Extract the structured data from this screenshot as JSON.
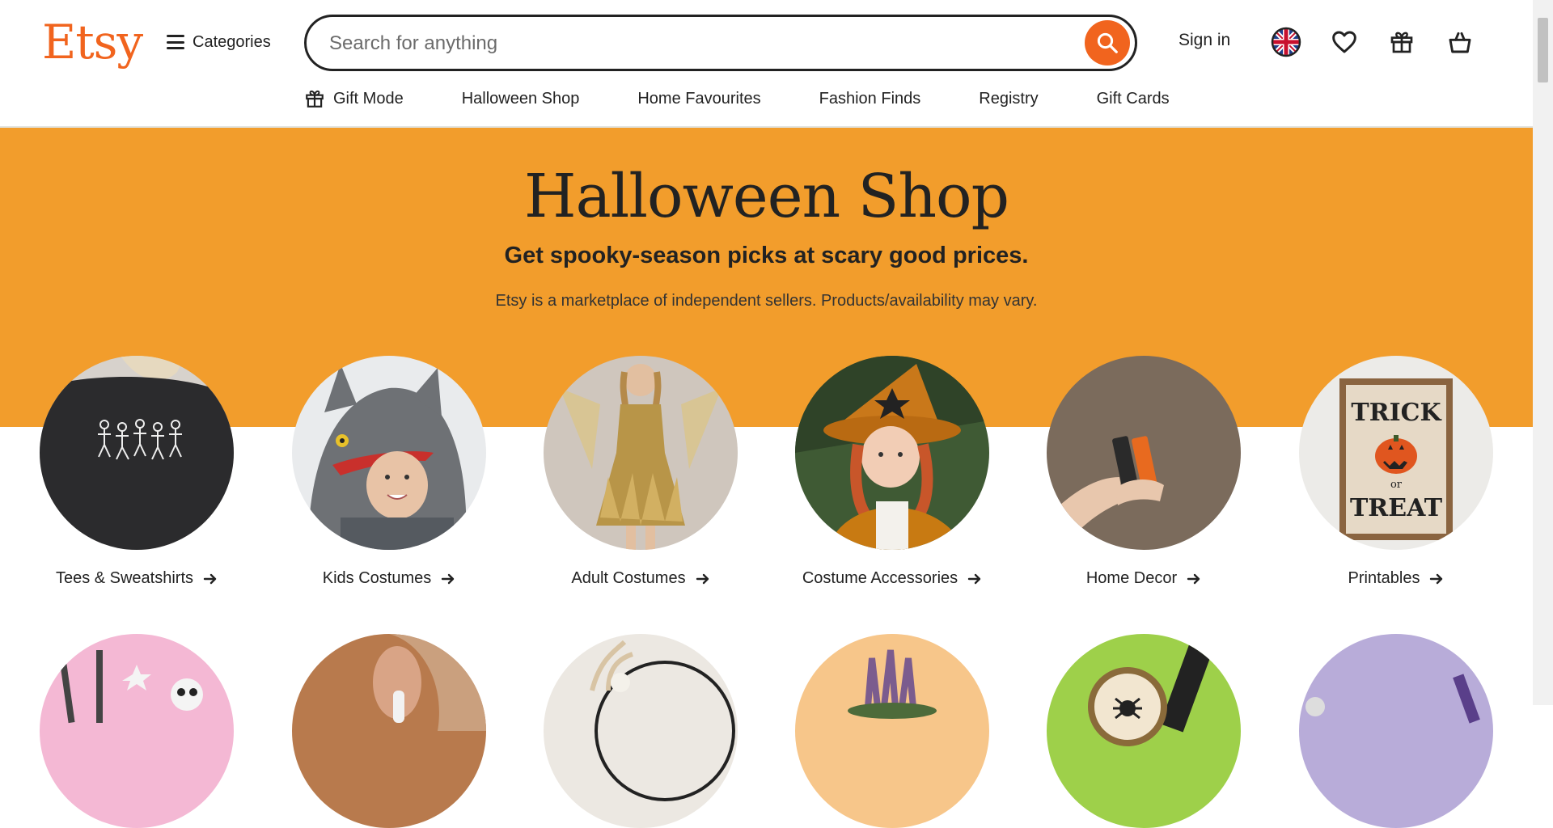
{
  "header": {
    "logo": "Etsy",
    "categories_label": "Categories",
    "search_placeholder": "Search for anything",
    "sign_in": "Sign in"
  },
  "subnav": {
    "items": [
      {
        "label": "Gift Mode",
        "icon": "gift-icon"
      },
      {
        "label": "Halloween Shop"
      },
      {
        "label": "Home Favourites"
      },
      {
        "label": "Fashion Finds"
      },
      {
        "label": "Registry"
      },
      {
        "label": "Gift Cards"
      }
    ]
  },
  "hero": {
    "title": "Halloween Shop",
    "subtitle": "Get spooky-season picks at scary good prices.",
    "note": "Etsy is a marketplace of independent sellers. Products/availability may vary."
  },
  "categories": [
    {
      "label": "Tees & Sweatshirts"
    },
    {
      "label": "Kids Costumes"
    },
    {
      "label": "Adult Costumes"
    },
    {
      "label": "Costume Accessories"
    },
    {
      "label": "Home Decor"
    },
    {
      "label": "Printables"
    }
  ],
  "printable_sign": {
    "line1": "TRICK",
    "line2": "or",
    "line3": "TREAT"
  },
  "colors": {
    "brand_orange": "#f1641e",
    "hero_background": "#f29d2c",
    "text": "#222222"
  }
}
